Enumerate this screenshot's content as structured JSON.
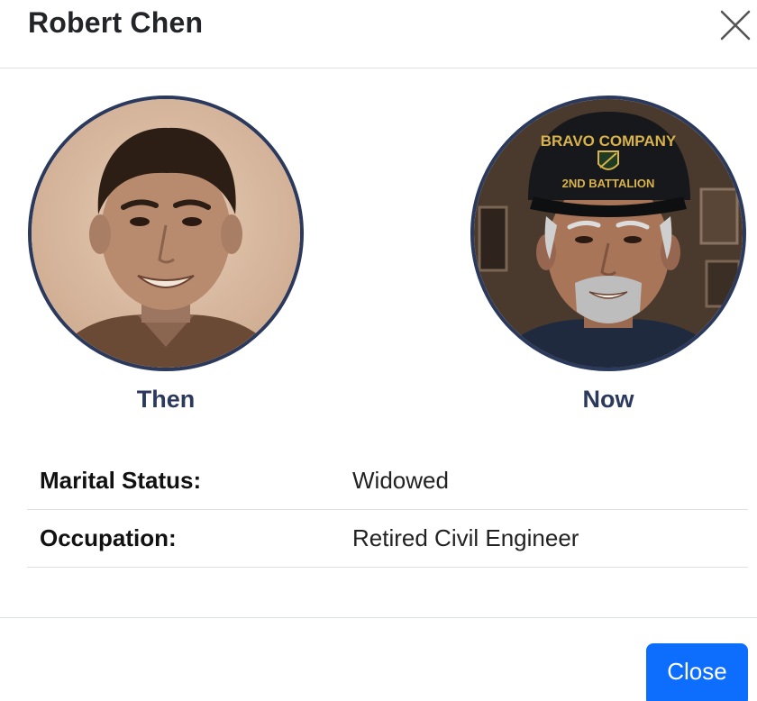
{
  "modal": {
    "title": "Robert Chen",
    "close_icon": "close-x-icon"
  },
  "photos": {
    "then": {
      "caption": "Then",
      "tone": "sepia"
    },
    "now": {
      "caption": "Now",
      "cap_text_top": "BRAVO COMPANY",
      "cap_text_bottom": "2ND BATTALION",
      "cap_emblem_icon": "shield-emblem-icon"
    }
  },
  "details": [
    {
      "label": "Marital Status:",
      "value": "Widowed"
    },
    {
      "label": "Occupation:",
      "value": "Retired Civil Engineer"
    }
  ],
  "footer": {
    "close_label": "Close"
  },
  "colors": {
    "accent": "#0d6efd",
    "caption_navy": "#2b3a5c",
    "divider": "#dee2e6"
  }
}
